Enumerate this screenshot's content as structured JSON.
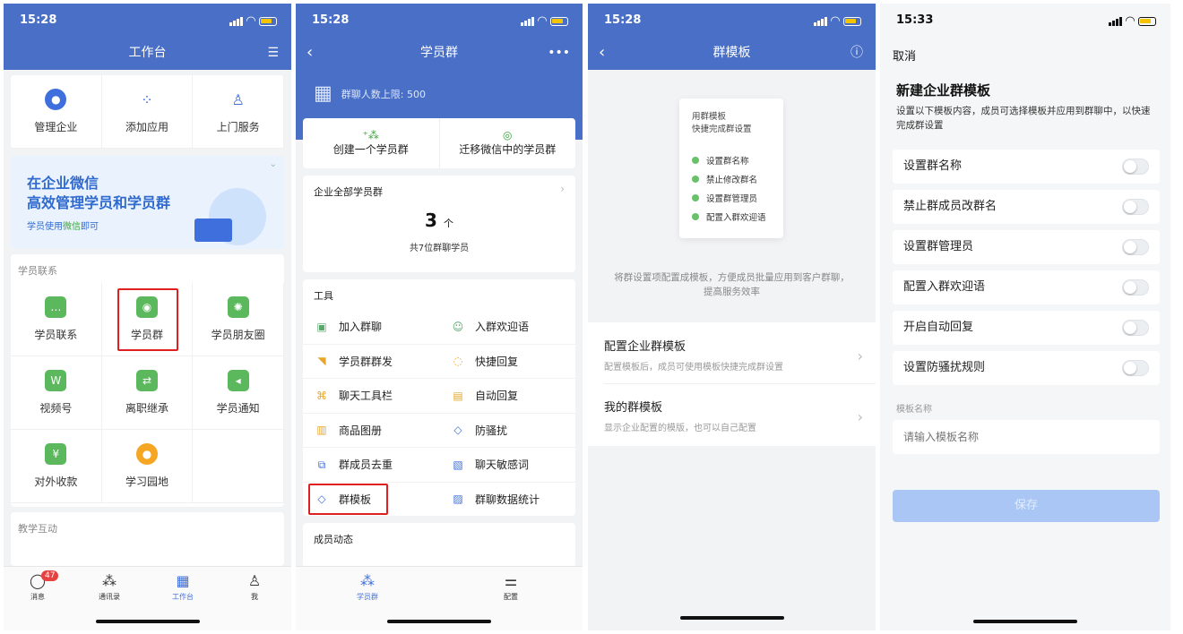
{
  "screen1": {
    "time": "15:28",
    "title": "工作台",
    "quick": [
      "管理企业",
      "添加应用",
      "上门服务"
    ],
    "banner": {
      "line1": "在企业微信",
      "line2": "高效管理学员和学员群",
      "sub_prefix": "学员使用",
      "sub_highlight": "微信",
      "sub_suffix": "即可"
    },
    "section1": "学员联系",
    "apps": [
      "学员联系",
      "学员群",
      "学员朋友圈",
      "视频号",
      "离职继承",
      "学员通知",
      "对外收款",
      "学习园地"
    ],
    "section2": "教学互动",
    "tabs": [
      "消息",
      "通讯录",
      "工作台",
      "我"
    ],
    "badge": "47"
  },
  "screen2": {
    "time": "15:28",
    "title": "学员群",
    "limit": "群聊人数上限: 500",
    "actions": [
      "创建一个学员群",
      "迁移微信中的学员群"
    ],
    "all_groups": "企业全部学员群",
    "count": "3",
    "count_unit": "个",
    "count_sub": "共7位群聊学员",
    "tools_title": "工具",
    "tools": [
      "加入群聊",
      "入群欢迎语",
      "学员群群发",
      "快捷回复",
      "聊天工具栏",
      "自动回复",
      "商品图册",
      "防骚扰",
      "群成员去重",
      "聊天敏感词",
      "群模板",
      "群聊数据统计"
    ],
    "member_title": "成员动态",
    "tabs": [
      "学员群",
      "配置"
    ]
  },
  "screen3": {
    "time": "15:28",
    "title": "群模板",
    "preview_title1": "用群模板",
    "preview_title2": "快捷完成群设置",
    "preview_items": [
      "设置群名称",
      "禁止修改群名",
      "设置群管理员",
      "配置入群欢迎语"
    ],
    "desc": "将群设置项配置成模板，方便成员批量应用到客户群聊，提高服务效率",
    "rows": [
      {
        "title": "配置企业群模板",
        "sub": "配置模板后，成员可使用模板快捷完成群设置"
      },
      {
        "title": "我的群模板",
        "sub": "显示企业配置的模版，也可以自己配置"
      }
    ]
  },
  "screen4": {
    "time": "15:33",
    "cancel": "取消",
    "title": "新建企业群模板",
    "desc": "设置以下模板内容，成员可选择模板并应用到群聊中，以快速完成群设置",
    "settings": [
      "设置群名称",
      "禁止群成员改群名",
      "设置群管理员",
      "配置入群欢迎语",
      "开启自动回复",
      "设置防骚扰规则"
    ],
    "name_label": "模板名称",
    "name_placeholder": "请输入模板名称",
    "save": "保存"
  },
  "colors": {
    "brand": "#4a6fc6",
    "green": "#5cb85c",
    "highlight": "#e02020"
  }
}
